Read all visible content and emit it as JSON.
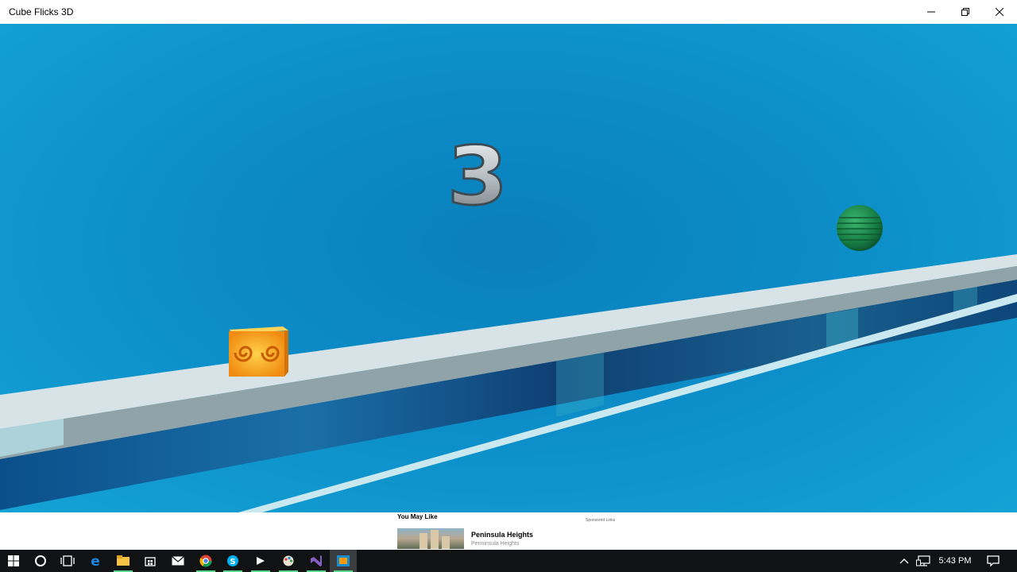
{
  "window": {
    "title": "Cube Flicks 3D",
    "minimize_icon": "minimize-icon",
    "maximize_icon": "restore-icon",
    "close_icon": "close-icon"
  },
  "game": {
    "countdown": "3",
    "player": "cube-with-orange-swirl",
    "obstacle": "green-striped-sphere",
    "colors": {
      "sky": "#0b8bc6",
      "track_top": "#dfe7e9",
      "cube": "#f5a41a",
      "ball": "#1e8e4e"
    }
  },
  "ad": {
    "heading": "You May Like",
    "sponsored": "Sponsored Links",
    "item_title": "Peninsula Heights",
    "item_subtitle": "Penninsula Heights"
  },
  "taskbar": {
    "icons": [
      "windows-start-icon",
      "cortana-icon",
      "task-view-icon",
      "edge-icon",
      "file-explorer-icon",
      "store-icon",
      "mail-icon",
      "chrome-icon",
      "skype-icon",
      "media-player-icon",
      "paint-icon",
      "visual-studio-icon",
      "cube-flicks-icon"
    ],
    "time": "5:43 PM"
  }
}
